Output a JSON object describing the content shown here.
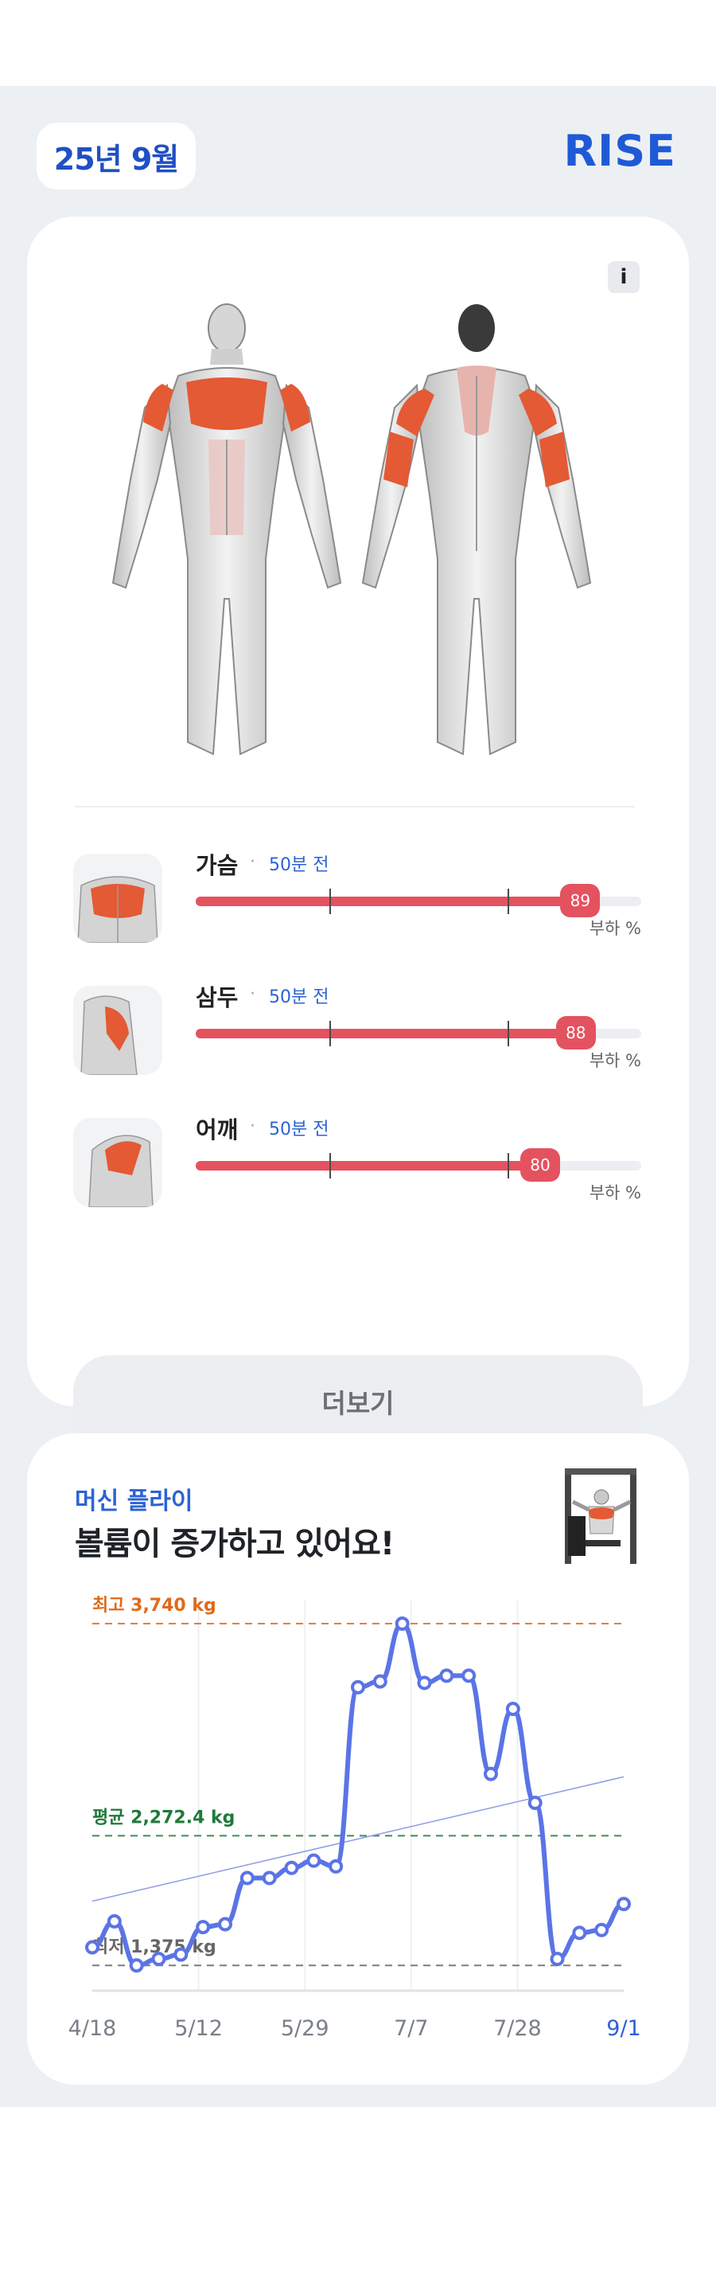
{
  "header": {
    "date_label": "25년 9월",
    "brand": "RISE"
  },
  "card_body": {
    "info_label": "i",
    "muscles": [
      {
        "name": "가슴",
        "ago": "50분 전",
        "load_percent": 89,
        "unit": "부하 %",
        "thumb": "chest"
      },
      {
        "name": "삼두",
        "ago": "50분 전",
        "load_percent": 88,
        "unit": "부하 %",
        "thumb": "triceps"
      },
      {
        "name": "어깨",
        "ago": "50분 전",
        "load_percent": 80,
        "unit": "부하 %",
        "thumb": "shoulder"
      }
    ],
    "more_label": "더보기"
  },
  "card_volume": {
    "machine": "머신 플라이",
    "headline": "볼륨이 증가하고 있어요!"
  },
  "colors": {
    "accent": "#2c62d6",
    "load_bar": "#e4525f",
    "line": "#5b74e6",
    "max": "#e06a1a",
    "avg": "#1f7a3a",
    "min": "#666666"
  },
  "chart_data": {
    "type": "line",
    "title": "",
    "x_tick_labels": [
      "4/18",
      "5/12",
      "5/29",
      "7/7",
      "7/28",
      "9/1"
    ],
    "ylim": [
      1200,
      3900
    ],
    "reference_lines": [
      {
        "label": "최고 3,740 kg",
        "value": 3740,
        "color": "#e06a1a"
      },
      {
        "label": "평균 2,272.4 kg",
        "value": 2272.4,
        "color": "#1f7a3a"
      },
      {
        "label": "최저 1,375 kg",
        "value": 1375,
        "color": "#666666"
      }
    ],
    "series": [
      {
        "values": [
          1500,
          1680,
          1375,
          1420,
          1450,
          1640,
          1660,
          1980,
          1980,
          2050,
          2100,
          2060,
          3300,
          3340,
          3740,
          3330,
          3380,
          3380,
          2700,
          3150,
          2500,
          1420,
          1600,
          1620,
          1800
        ]
      }
    ],
    "trend": {
      "start": 1820,
      "end": 2680
    }
  }
}
